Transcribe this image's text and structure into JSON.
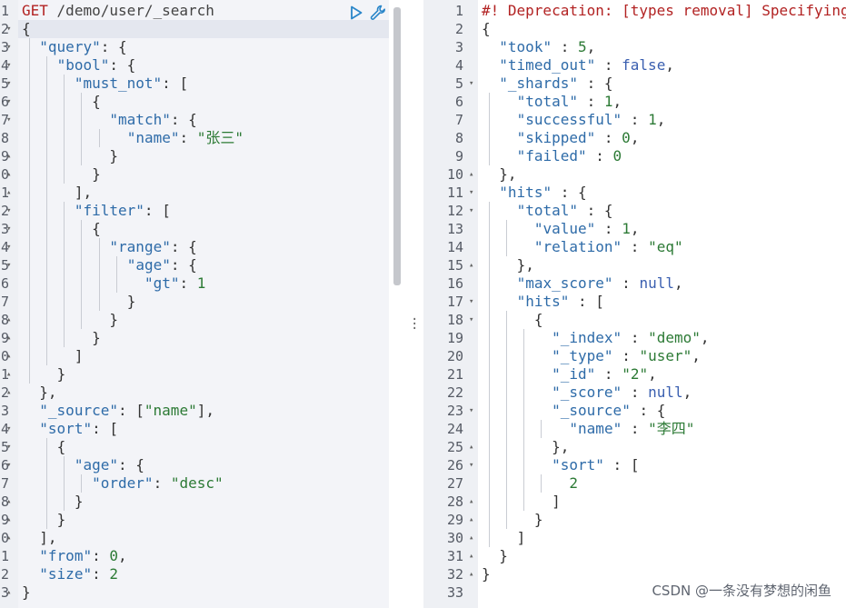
{
  "request": {
    "method": "GET",
    "path": "/demo/user/_search",
    "body_lines": [
      "{",
      "  \"query\": {",
      "    \"bool\": {",
      "      \"must_not\": [",
      "        {",
      "          \"match\": {",
      "            \"name\": \"张三\"",
      "          }",
      "        }",
      "      ],",
      "      \"filter\": [",
      "        {",
      "          \"range\": {",
      "            \"age\": {",
      "              \"gt\": 1",
      "            }",
      "          }",
      "        }",
      "      ]",
      "    }",
      "  },",
      "  \"_source\": [\"name\"],",
      "  \"sort\": [",
      "    {",
      "      \"age\": {",
      "        \"order\": \"desc\"",
      "      }",
      "    }",
      "  ],",
      "  \"from\": 0,",
      "  \"size\": 2",
      "}"
    ],
    "line_numbers": [
      "1",
      "2",
      "3",
      "4",
      "5",
      "6",
      "7",
      "8",
      "9",
      "0",
      "1",
      "2",
      "3",
      "4",
      "5",
      "6",
      "7",
      "8",
      "9",
      "0",
      "1",
      "2",
      "3",
      "4",
      "5",
      "6",
      "7",
      "8",
      "9",
      "0",
      "1",
      "2",
      "3"
    ]
  },
  "response": {
    "lines": [
      "#! Deprecation: [types removal] Specifying",
      "{",
      "  \"took\" : 5,",
      "  \"timed_out\" : false,",
      "  \"_shards\" : {",
      "    \"total\" : 1,",
      "    \"successful\" : 1,",
      "    \"skipped\" : 0,",
      "    \"failed\" : 0",
      "  },",
      "  \"hits\" : {",
      "    \"total\" : {",
      "      \"value\" : 1,",
      "      \"relation\" : \"eq\"",
      "    },",
      "    \"max_score\" : null,",
      "    \"hits\" : [",
      "      {",
      "        \"_index\" : \"demo\",",
      "        \"_type\" : \"user\",",
      "        \"_id\" : \"2\",",
      "        \"_score\" : null,",
      "        \"_source\" : {",
      "          \"name\" : \"李四\"",
      "        },",
      "        \"sort\" : [",
      "          2",
      "        ]",
      "      }",
      "    ]",
      "  }",
      "}",
      ""
    ]
  },
  "icons": {
    "run": "play-icon",
    "settings": "wrench-icon",
    "resize": "vertical-dots-icon"
  },
  "watermark": "CSDN @一条没有梦想的闲鱼",
  "colors": {
    "key": "#2e6ba8",
    "string": "#2c7a35",
    "method": "#b22222",
    "gutter": "#eef0f4",
    "editor_bg": "#f3f4f8"
  }
}
